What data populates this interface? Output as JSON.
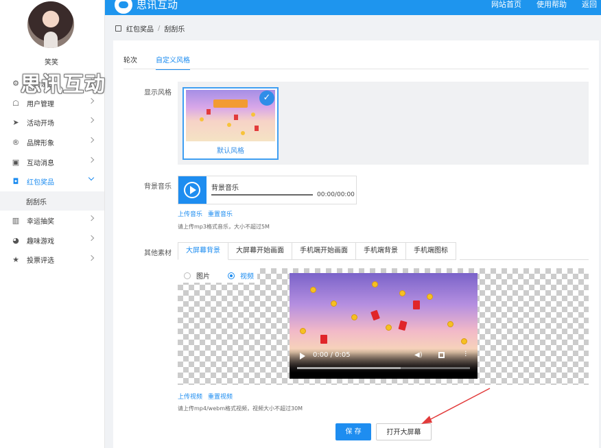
{
  "topbar": {
    "brand": "思讯互动",
    "nav": [
      "网站首页",
      "使用帮助",
      "返回"
    ]
  },
  "user": {
    "name": "笑笑"
  },
  "watermark": "思讯互动",
  "menu": [
    {
      "label": "活动设置",
      "icon": "gear-icon"
    },
    {
      "label": "用户管理",
      "icon": "user-icon"
    },
    {
      "label": "活动开场",
      "icon": "send-icon"
    },
    {
      "label": "品牌形象",
      "icon": "registered-icon"
    },
    {
      "label": "互动消息",
      "icon": "chat-icon"
    },
    {
      "label": "红包奖品",
      "icon": "gift-icon",
      "active": true
    },
    {
      "label": "刮刮乐",
      "sub": true
    },
    {
      "label": "幸运抽奖",
      "icon": "chart-icon"
    },
    {
      "label": "趣味游戏",
      "icon": "game-icon"
    },
    {
      "label": "投票评选",
      "icon": "star-icon"
    }
  ],
  "breadcrumb": [
    "红包奖品",
    "刮刮乐"
  ],
  "tabs": [
    "轮次",
    "自定义风格"
  ],
  "labels": {
    "display_style": "显示风格",
    "bg_music": "背景音乐",
    "other_material": "其他素材"
  },
  "style": {
    "name": "默认风格"
  },
  "music": {
    "title": "背景音乐",
    "time": "00:00/00:00",
    "upload": "上传音乐",
    "reset": "重置音乐",
    "hint": "请上传mp3格式音乐，大小不超过5M"
  },
  "material_tabs": [
    "大屏幕背景",
    "大屏幕开始画面",
    "手机端开始画面",
    "手机端背景",
    "手机端图标"
  ],
  "media_type": {
    "image": "图片",
    "video": "视频"
  },
  "video": {
    "time": "0:00 / 0:05",
    "progress": 0.6
  },
  "video_links": {
    "upload": "上传视频",
    "reset": "重置视频",
    "hint": "请上传mp4/webm格式视频，视频大小不超过30M"
  },
  "buttons": {
    "save": "保 存",
    "open_screen": "打开大屏幕"
  },
  "colors": {
    "primary": "#1e95ee",
    "annotation": "#e23b3b"
  }
}
